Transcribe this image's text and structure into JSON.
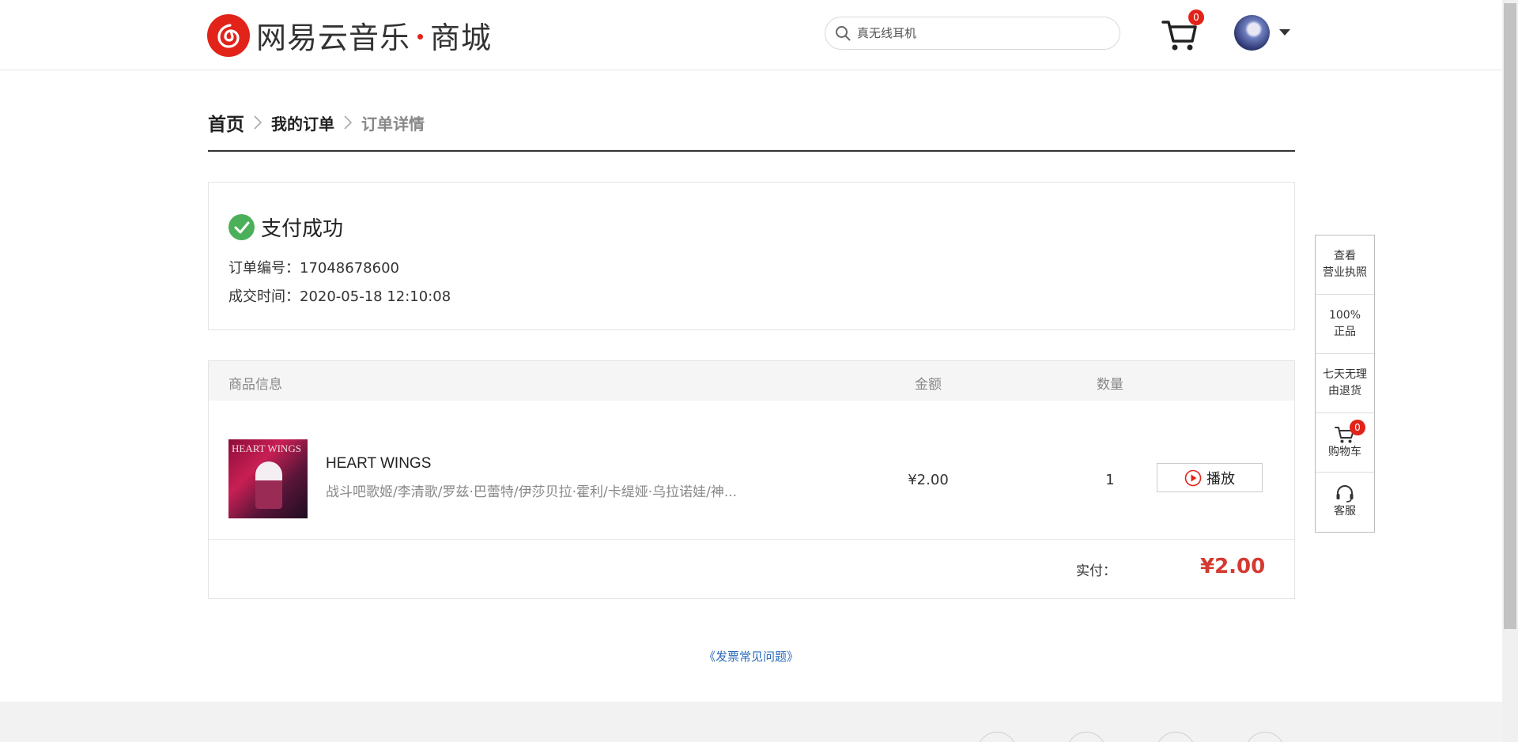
{
  "header": {
    "logo_brand": "网易云音乐",
    "logo_store": "商城",
    "search_placeholder": "真无线耳机",
    "cart_count": "0"
  },
  "breadcrumb": {
    "home": "首页",
    "orders": "我的订单",
    "current": "订单详情"
  },
  "status": {
    "title": "支付成功",
    "order_no_label": "订单编号：",
    "order_no": "17048678600",
    "time_label": "成交时间：",
    "time": "2020-05-18 12:10:08"
  },
  "table": {
    "headers": {
      "info": "商品信息",
      "amount": "金额",
      "quantity": "数量"
    },
    "item": {
      "cover_text": "HEART WINGS",
      "name": "HEART WINGS",
      "artists": "战斗吧歌姬/李清歌/罗兹·巴蕾特/伊莎贝拉·霍利/卡缇娅·乌拉诺娃/神...",
      "price": "¥2.00",
      "quantity": "1",
      "play_label": "播放"
    },
    "paid_label": "实付：",
    "paid_amount": "¥2.00"
  },
  "faq_link": "《发票常见问题》",
  "side": {
    "license": [
      "查看",
      "营业执照"
    ],
    "genuine": [
      "100%",
      "正品"
    ],
    "returns": [
      "七天无理",
      "由退货"
    ],
    "cart_label": "购物车",
    "cart_count": "0",
    "service_label": "客服"
  },
  "colors": {
    "brand_red": "#e2231a",
    "success_green": "#4cb05a",
    "price_red": "#d33a31",
    "link_blue": "#2b6bb9"
  }
}
